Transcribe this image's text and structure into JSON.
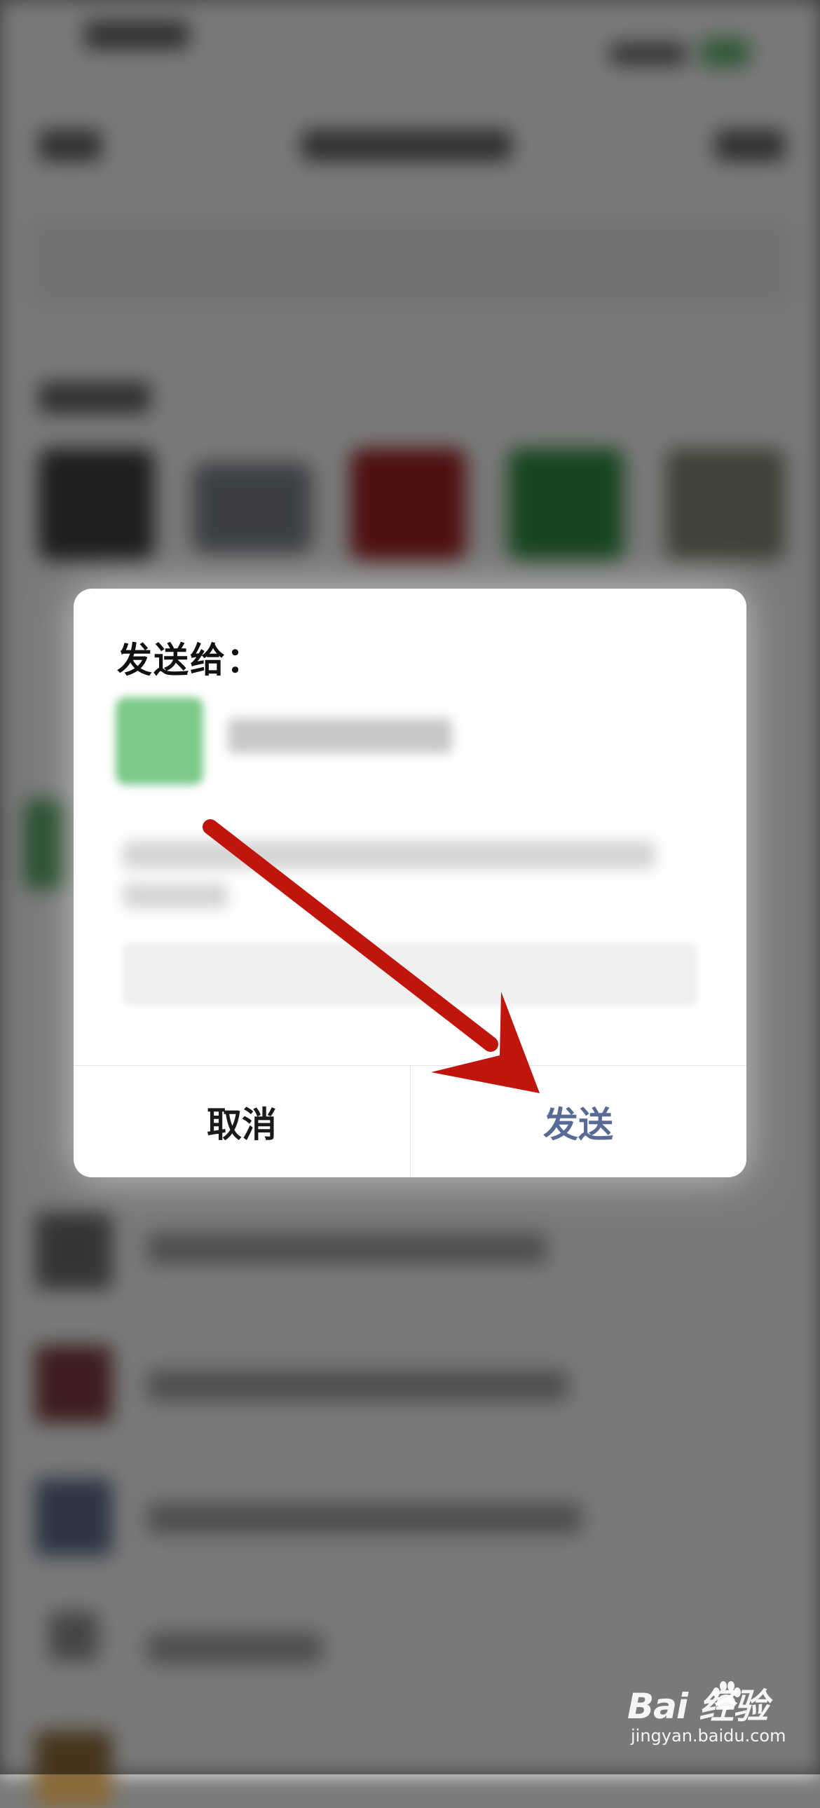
{
  "dialog": {
    "title": "发送给：",
    "cancel_label": "取消",
    "send_label": "发送"
  },
  "watermark": {
    "brand": "Bai  经验",
    "url": "jingyan.baidu.com"
  },
  "colors": {
    "send_text": "#576b95",
    "annotation_arrow": "#c0150c"
  },
  "icons": {
    "annotation": "arrow-pointing-to-send"
  }
}
